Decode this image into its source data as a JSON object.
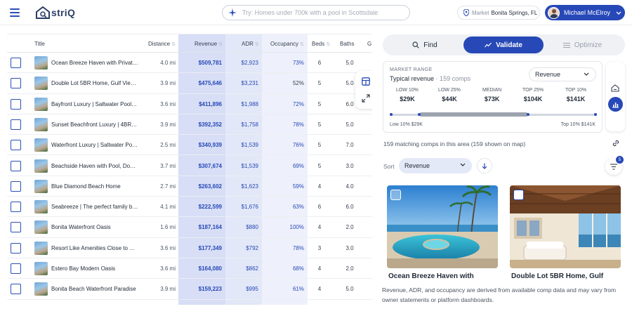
{
  "header": {
    "logo_text": "striQ",
    "search_placeholder": "Try: Homes under 700k with a pool in Scottsdale",
    "market_label": "Market",
    "market_value": "Bonita Springs, FL",
    "user_name": "Michael McElroy"
  },
  "table": {
    "columns": {
      "title": "Title",
      "distance": "Distance",
      "revenue": "Revenue",
      "adr": "ADR",
      "occupancy": "Occupancy",
      "beds": "Beds",
      "baths": "Baths",
      "extra": "G"
    },
    "sort_glyph": "⇅",
    "rows": [
      {
        "title": "Ocean Breeze Haven with Private…",
        "distance": "4.0 mi",
        "revenue": "$509,781",
        "adr": "$2,923",
        "occupancy": "73%",
        "beds": "6",
        "baths": "5.0"
      },
      {
        "title": "Double Lot 5BR Home, Gulf View…",
        "distance": "3.9 mi",
        "revenue": "$475,646",
        "adr": "$3,231",
        "occupancy": "52%",
        "beds": "5",
        "baths": "5.0"
      },
      {
        "title": "Bayfront Luxury | Saltwater Pool, …",
        "distance": "3.6 mi",
        "revenue": "$411,896",
        "adr": "$1,988",
        "occupancy": "72%",
        "beds": "5",
        "baths": "6.0"
      },
      {
        "title": "Sunset Beachfront Luxury | 4BR+…",
        "distance": "3.9 mi",
        "revenue": "$392,352",
        "adr": "$1,758",
        "occupancy": "78%",
        "beds": "5",
        "baths": "5.0"
      },
      {
        "title": "Waterfront Luxury | Saltwater Po…",
        "distance": "2.5 mi",
        "revenue": "$340,939",
        "adr": "$1,539",
        "occupancy": "76%",
        "beds": "5",
        "baths": "7.0"
      },
      {
        "title": "Beachside Haven with Pool, Dock…",
        "distance": "3.7 mi",
        "revenue": "$307,674",
        "adr": "$1,539",
        "occupancy": "69%",
        "beds": "5",
        "baths": "3.0"
      },
      {
        "title": "Blue Diamond Beach Home",
        "distance": "2.7 mi",
        "revenue": "$263,602",
        "adr": "$1,623",
        "occupancy": "59%",
        "beds": "4",
        "baths": "4.0"
      },
      {
        "title": "Seabreeze | The perfect family b…",
        "distance": "4.1 mi",
        "revenue": "$222,599",
        "adr": "$1,676",
        "occupancy": "63%",
        "beds": "6",
        "baths": "6.0"
      },
      {
        "title": "Bonita Waterfront Oasis",
        "distance": "1.6 mi",
        "revenue": "$187,164",
        "adr": "$880",
        "occupancy": "100%",
        "beds": "4",
        "baths": "2.0"
      },
      {
        "title": "Resort Like Amenities Close to Be…",
        "distance": "3.6 mi",
        "revenue": "$177,349",
        "adr": "$792",
        "occupancy": "78%",
        "beds": "3",
        "baths": "3.0"
      },
      {
        "title": "Estero Bay Modern Oasis",
        "distance": "3.6 mi",
        "revenue": "$164,080",
        "adr": "$862",
        "occupancy": "68%",
        "beds": "4",
        "baths": "2.0"
      },
      {
        "title": "Bonita Beach Waterfront Paradise",
        "distance": "3.9 mi",
        "revenue": "$159,223",
        "adr": "$995",
        "occupancy": "61%",
        "beds": "4",
        "baths": "5.0"
      }
    ]
  },
  "tabs": {
    "find": "Find",
    "validate": "Validate",
    "optimize": "Optimize"
  },
  "market_range": {
    "title": "MARKET RANGE",
    "subtitle": "Typical revenue",
    "comps_suffix": "· 159 comps",
    "metric_select": "Revenue",
    "stats": [
      {
        "label": "LOW 10%",
        "value": "$29K"
      },
      {
        "label": "LOW 25%",
        "value": "$44K"
      },
      {
        "label": "MEDIAN",
        "value": "$73K"
      },
      {
        "label": "TOP 25%",
        "value": "$104K"
      },
      {
        "label": "TOP 10%",
        "value": "$141K"
      }
    ],
    "track_left": "Low 10% $29K",
    "track_right": "Top 10% $141K"
  },
  "comps": {
    "count_text": "159 matching comps in this area (159 shown on map)",
    "sort_label": "Sort",
    "sort_value": "Revenue",
    "filter_count": "5",
    "cards": [
      {
        "title": "Ocean Breeze Haven with"
      },
      {
        "title": "Double Lot 5BR Home, Gulf"
      }
    ],
    "disclaimer": "Revenue, ADR, and occupancy are derived from available comp data and may vary from owner statements or platform dashboards."
  },
  "colors": {
    "brand": "#2748b7",
    "revenue_column": "#d7def6",
    "adr_column": "#e3e8f8",
    "occupancy_column": "#eef1fb"
  }
}
